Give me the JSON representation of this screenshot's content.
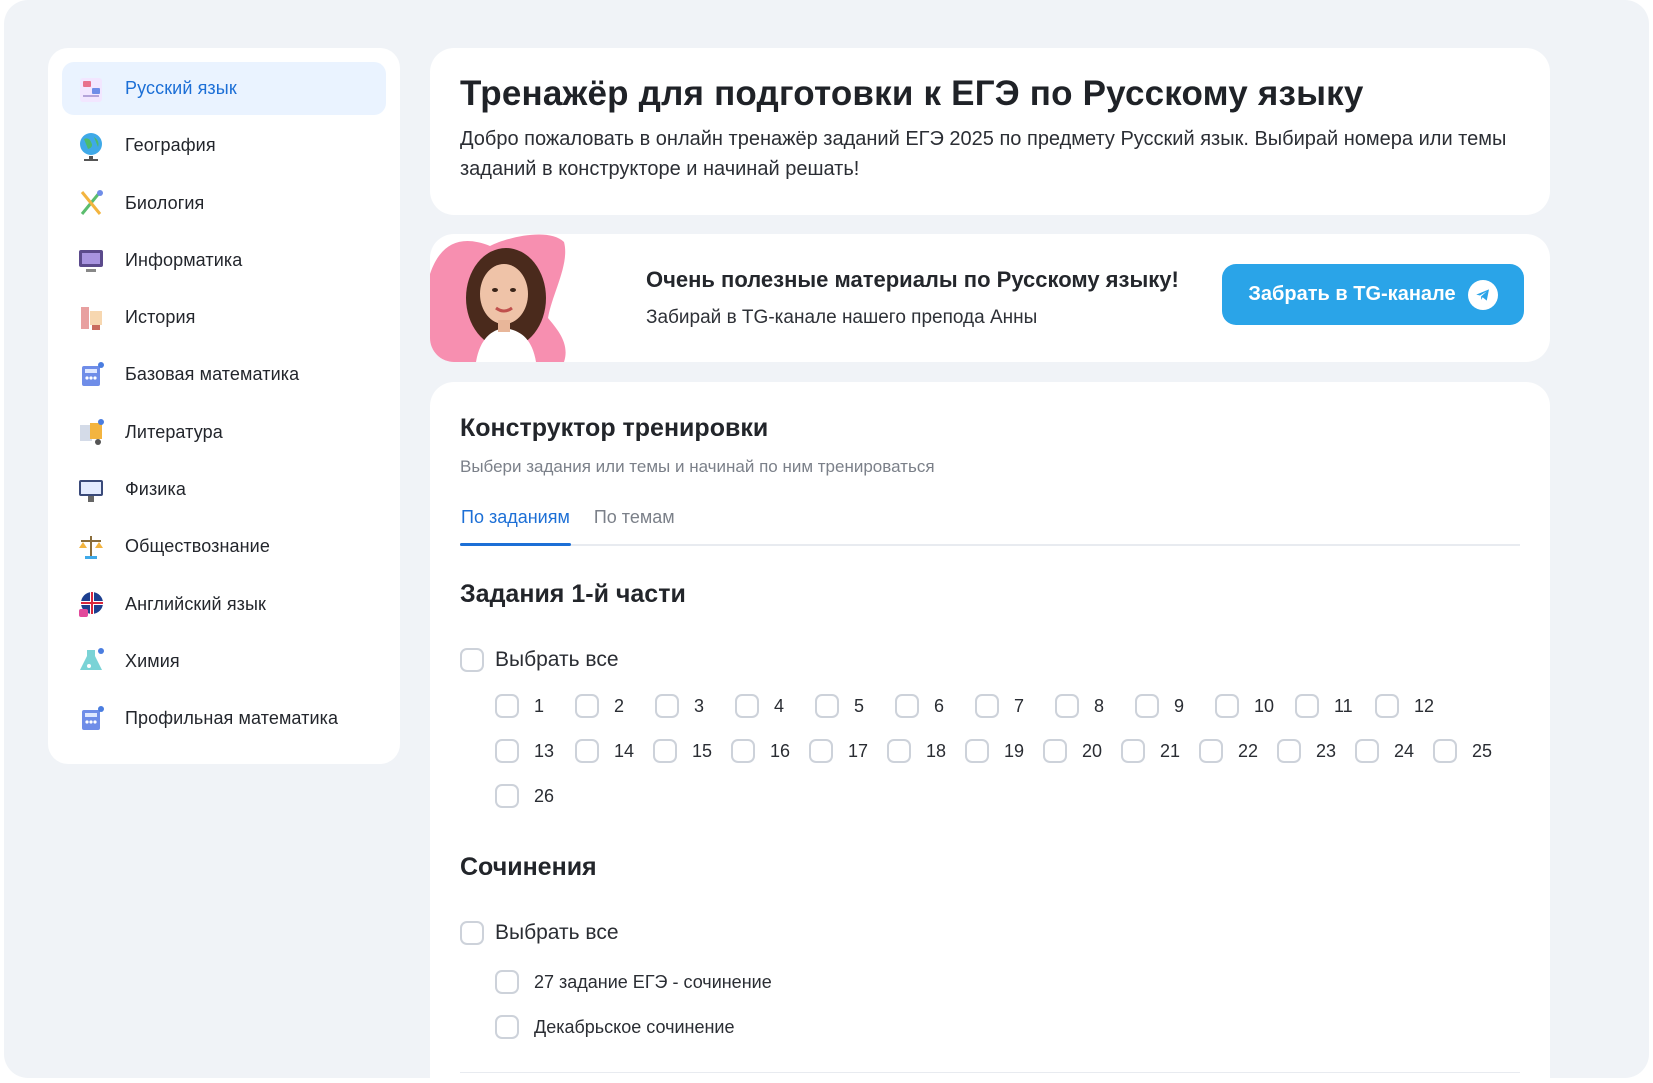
{
  "colors": {
    "accent": "#1c6fd6",
    "telegram": "#2aa4e8",
    "background": "#f0f3f7"
  },
  "sidebar": {
    "items": [
      {
        "label": "Русский язык",
        "icon": "russian-book-icon",
        "active": true
      },
      {
        "label": "География",
        "icon": "globe-icon"
      },
      {
        "label": "Биология",
        "icon": "dna-icon"
      },
      {
        "label": "Информатика",
        "icon": "computer-icon"
      },
      {
        "label": "История",
        "icon": "history-scroll-icon"
      },
      {
        "label": "Базовая математика",
        "icon": "calculator-icon"
      },
      {
        "label": "Литература",
        "icon": "literature-book-icon"
      },
      {
        "label": "Физика",
        "icon": "physics-board-icon"
      },
      {
        "label": "Обществознание",
        "icon": "scales-icon"
      },
      {
        "label": "Английский язык",
        "icon": "uk-flag-icon"
      },
      {
        "label": "Химия",
        "icon": "flask-icon"
      },
      {
        "label": "Профильная математика",
        "icon": "calculator-pro-icon"
      }
    ]
  },
  "intro": {
    "title": "Тренажёр для подготовки к ЕГЭ по Русскому языку",
    "text": "Добро пожаловать в онлайн тренажёр заданий ЕГЭ 2025 по предмету Русский язык. Выбирай номера или темы заданий в конструкторе и начинай решать!"
  },
  "promo": {
    "title": "Очень полезные материалы по Русскому языку!",
    "subtitle": "Забирай в TG-канале нашего препода Анны",
    "button": "Забрать в TG-канале",
    "button_icon": "telegram-icon"
  },
  "builder": {
    "title": "Конструктор тренировки",
    "subtitle": "Выбери задания или темы и начинай по ним тренироваться",
    "tabs": [
      {
        "label": "По заданиям",
        "active": true
      },
      {
        "label": "По темам",
        "active": false
      }
    ],
    "part1": {
      "title": "Задания 1-й части",
      "select_all": "Выбрать все",
      "tasks": [
        "1",
        "2",
        "3",
        "4",
        "5",
        "6",
        "7",
        "8",
        "9",
        "10",
        "11",
        "12",
        "13",
        "14",
        "15",
        "16",
        "17",
        "18",
        "19",
        "20",
        "21",
        "22",
        "23",
        "24",
        "25",
        "26"
      ]
    },
    "essays": {
      "title": "Сочинения",
      "select_all": "Выбрать все",
      "items": [
        "27 задание ЕГЭ - сочинение",
        "Декабрьское сочинение"
      ]
    }
  }
}
